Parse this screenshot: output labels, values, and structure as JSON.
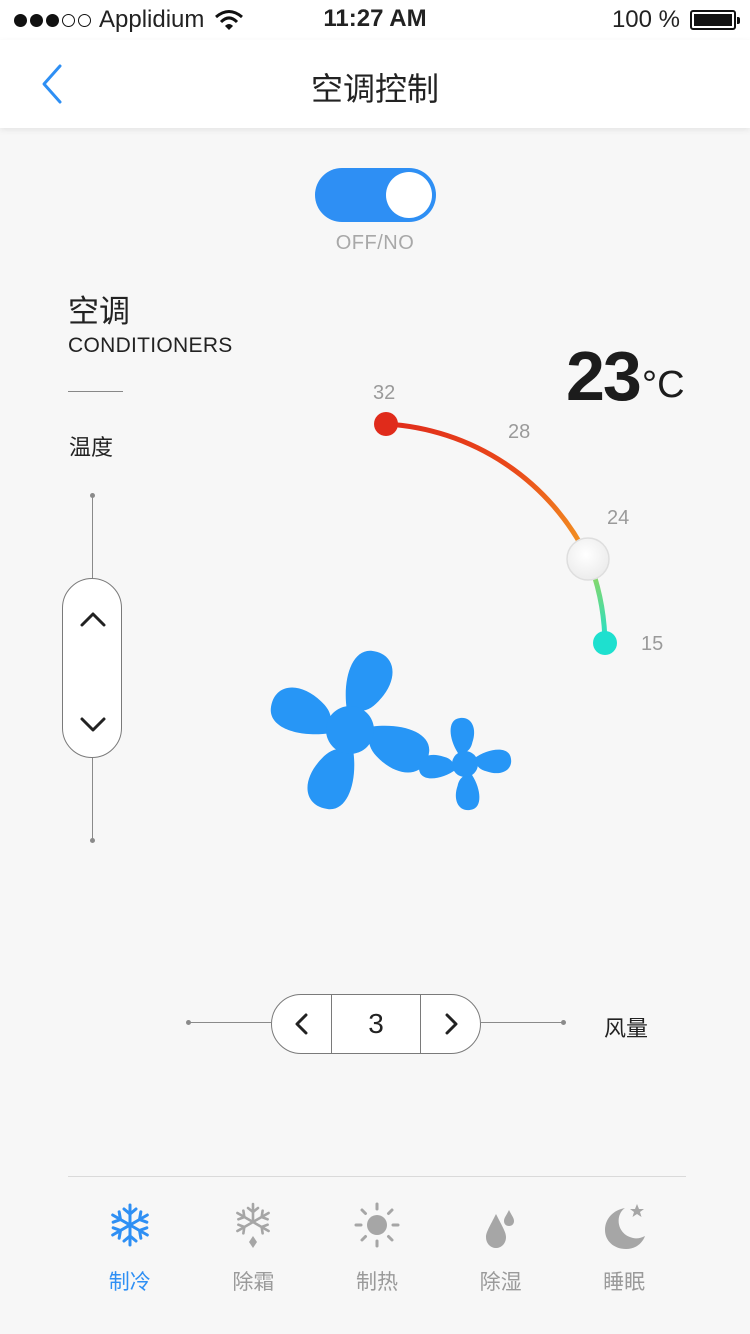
{
  "status_bar": {
    "carrier": "Applidium",
    "time": "11:27 AM",
    "battery": "100 %",
    "signal_dots_filled": 3,
    "signal_dots_total": 5
  },
  "nav": {
    "title": "空调控制",
    "back_icon": "chevron-left-icon"
  },
  "power": {
    "label": "OFF/NO",
    "on": true
  },
  "device": {
    "name_cn": "空调",
    "name_en": "CONDITIONERS"
  },
  "temperature": {
    "label": "温度",
    "value": "23",
    "unit": "°C",
    "dial_ticks": [
      "32",
      "28",
      "24",
      "15"
    ],
    "min": 15,
    "max": 32
  },
  "fan": {
    "label": "风量",
    "speed": "3"
  },
  "modes": [
    {
      "label": "制冷",
      "icon": "snowflake-icon",
      "active": true
    },
    {
      "label": "除霜",
      "icon": "defrost-icon",
      "active": false
    },
    {
      "label": "制热",
      "icon": "sun-icon",
      "active": false
    },
    {
      "label": "除湿",
      "icon": "droplet-icon",
      "active": false
    },
    {
      "label": "睡眠",
      "icon": "moon-star-icon",
      "active": false
    }
  ],
  "colors": {
    "accent": "#2e8ff4",
    "dial_hot": "#e02b1b",
    "dial_warm": "#f08c22",
    "dial_cool": "#1ee0cf",
    "inactive": "#a6a6a6"
  }
}
